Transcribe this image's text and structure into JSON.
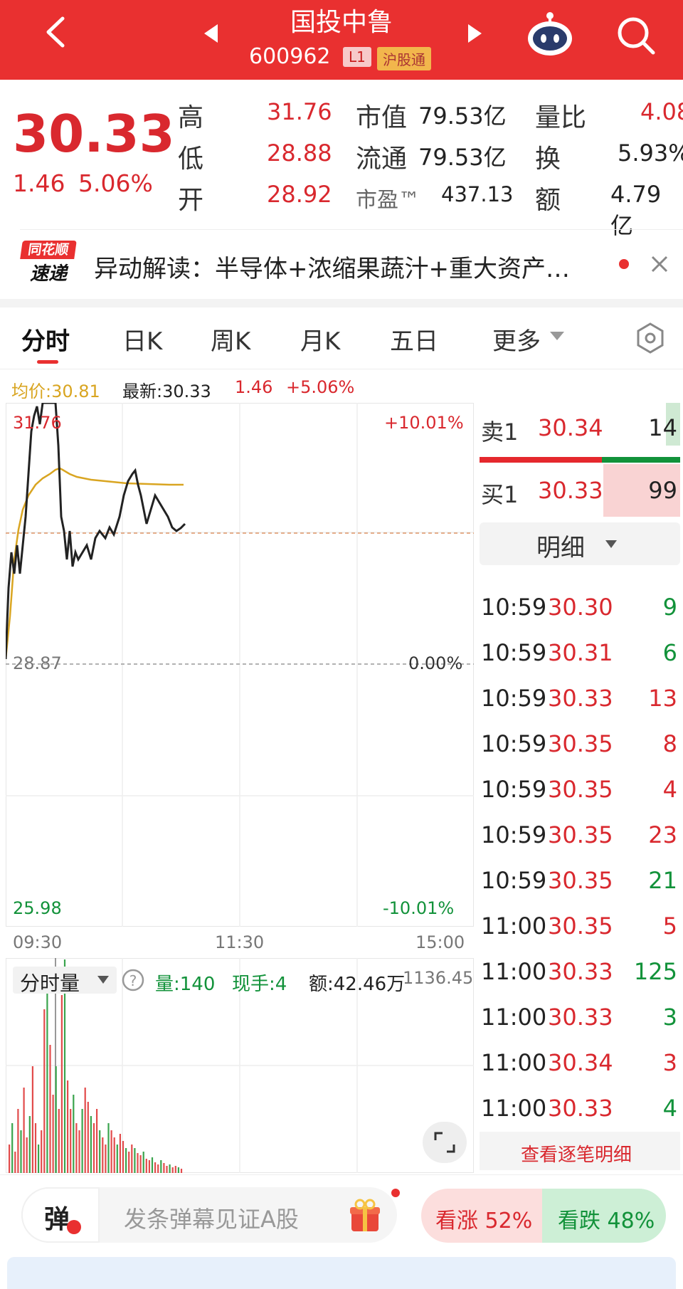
{
  "header": {
    "title": "国投中鲁",
    "code": "600962",
    "tag_level": "L1",
    "tag_connect": "沪股通",
    "back_icon": "chevron-left-icon",
    "prev_icon": "triangle-left-icon",
    "next_icon": "triangle-right-icon",
    "robot_icon": "robot-icon",
    "search_icon": "search-icon"
  },
  "quote": {
    "price": "30.33",
    "change": "1.46",
    "change_pct": "5.06%",
    "high_label": "高",
    "high": "31.76",
    "low_label": "低",
    "low": "28.88",
    "open_label": "开",
    "open": "28.92",
    "mcap_label": "市值",
    "mcap": "79.53亿",
    "float_label": "流通",
    "float": "79.53亿",
    "pe_label": "市盈™",
    "pe": "437.13",
    "vr_label": "量比",
    "vr": "4.08",
    "turnover_label": "换",
    "turnover": "5.93%",
    "amount_label": "额",
    "amount": "4.79亿"
  },
  "news": {
    "logo_top": "同花顺",
    "logo_bottom": "速递",
    "text": "异动解读：半导体+浓缩果蔬汁+重大资产…"
  },
  "tabs": [
    "分时",
    "日K",
    "周K",
    "月K",
    "五日",
    "更多"
  ],
  "chart_info": {
    "avg": "均价:30.81",
    "latest": "最新:30.33",
    "chg": "1.46",
    "chg_pct": "+5.06%"
  },
  "chart_axis": {
    "top_price": "31.76",
    "mid_price": "28.87",
    "bottom_price": "25.98",
    "top_pct": "+10.01%",
    "mid_pct": "0.00%",
    "bottom_pct": "-10.01%",
    "t_start": "09:30",
    "t_mid": "11:30",
    "t_end": "15:00"
  },
  "volume": {
    "label": "分时量",
    "qty": "量:140",
    "hand": "现手:4",
    "amt": "额:42.46万",
    "max": "1136.45"
  },
  "orderbook": {
    "sell_label": "卖1",
    "sell_price": "30.34",
    "sell_qty": "14",
    "buy_label": "买1",
    "buy_price": "30.33",
    "buy_qty": "99",
    "detail_label": "明细"
  },
  "trades": [
    {
      "time": "10:59",
      "price": "30.30",
      "qty": "9",
      "dir": "green"
    },
    {
      "time": "10:59",
      "price": "30.31",
      "qty": "6",
      "dir": "green"
    },
    {
      "time": "10:59",
      "price": "30.33",
      "qty": "13",
      "dir": "red"
    },
    {
      "time": "10:59",
      "price": "30.35",
      "qty": "8",
      "dir": "red"
    },
    {
      "time": "10:59",
      "price": "30.35",
      "qty": "4",
      "dir": "red"
    },
    {
      "time": "10:59",
      "price": "30.35",
      "qty": "23",
      "dir": "red"
    },
    {
      "time": "10:59",
      "price": "30.35",
      "qty": "21",
      "dir": "green"
    },
    {
      "time": "11:00",
      "price": "30.35",
      "qty": "5",
      "dir": "red"
    },
    {
      "time": "11:00",
      "price": "30.33",
      "qty": "125",
      "dir": "green"
    },
    {
      "time": "11:00",
      "price": "30.33",
      "qty": "3",
      "dir": "green"
    },
    {
      "time": "11:00",
      "price": "30.34",
      "qty": "3",
      "dir": "red"
    },
    {
      "time": "11:00",
      "price": "30.33",
      "qty": "4",
      "dir": "green"
    }
  ],
  "trades_more": "查看逐笔明细",
  "bottom": {
    "danmu_icon": "弹",
    "danmu_placeholder": "发条弹幕见证A股",
    "bull": "看涨 52%",
    "bear": "看跌 48%"
  },
  "colors": {
    "brand": "#e93030",
    "up": "#d9282e",
    "down": "#12923a",
    "avg_line": "#d9a521"
  }
}
